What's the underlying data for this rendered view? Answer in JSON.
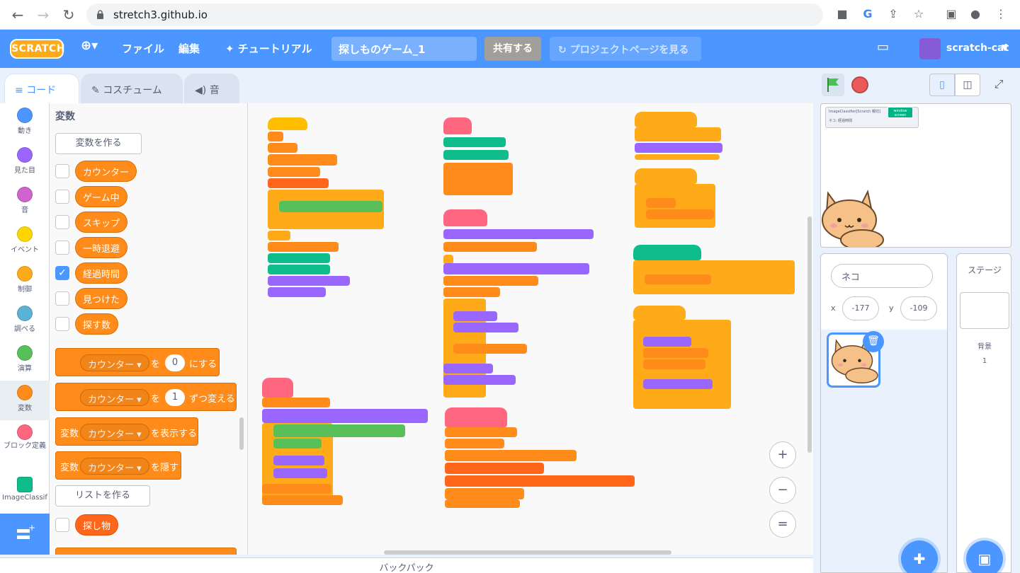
{
  "browser": {
    "url": "stretch3.github.io",
    "nav": {
      "back": "←",
      "forward": "→",
      "reload": "↻"
    }
  },
  "menubar": {
    "logo": "SCRATCH",
    "language_icon": "globe-icon",
    "file": "ファイル",
    "edit": "編集",
    "tutorials": "チュートリアル",
    "project_title": "探しものゲーム_1",
    "share": "共有する",
    "see_project_page": "プロジェクトページを見る",
    "username": "scratch-cat"
  },
  "tabs": [
    {
      "label": "コード",
      "active": true
    },
    {
      "label": "コスチューム",
      "active": false
    },
    {
      "label": "音",
      "active": false
    }
  ],
  "categories": [
    {
      "label": "動き",
      "color": "#4c97ff"
    },
    {
      "label": "見た目",
      "color": "#9966ff"
    },
    {
      "label": "音",
      "color": "#cf63cf"
    },
    {
      "label": "イベント",
      "color": "#ffd500"
    },
    {
      "label": "制御",
      "color": "#ffab19"
    },
    {
      "label": "調べる",
      "color": "#5cb1d6"
    },
    {
      "label": "演算",
      "color": "#59c059"
    },
    {
      "label": "変数",
      "color": "#ff8c1a"
    },
    {
      "label": "ブロック定義",
      "color": "#ff6680"
    },
    {
      "label": "ImageClassif",
      "color": "#0fbd8c"
    }
  ],
  "palette": {
    "title": "変数",
    "make_variable": "変数を作る",
    "variables": [
      {
        "name": "カウンター",
        "checked": false
      },
      {
        "name": "ゲーム中",
        "checked": false
      },
      {
        "name": "スキップ",
        "checked": false
      },
      {
        "name": "一時退避",
        "checked": false
      },
      {
        "name": "経過時間",
        "checked": true
      },
      {
        "name": "見つけた",
        "checked": false
      },
      {
        "name": "探す数",
        "checked": false
      }
    ],
    "blocks": {
      "set_var": "カウンター",
      "set_to": "を",
      "set_value": "0",
      "set_suffix": "にする",
      "change_var": "カウンター",
      "change_to": "を",
      "change_value": "1",
      "change_suffix": "ずつ変える",
      "show_prefix": "変数",
      "show_var": "カウンター",
      "show_suffix": "を表示する",
      "hide_prefix": "変数",
      "hide_var": "カウンター",
      "hide_suffix": "を隠す"
    },
    "make_list": "リストを作る",
    "lists": [
      {
        "name": "探し物",
        "checked": false
      }
    ]
  },
  "workspace": {
    "zoom_in": "+",
    "zoom_out": "−",
    "reset": "="
  },
  "backpack": "バックパック",
  "stage": {
    "monitor_title": "ImageClassifier[Scratch 親切]",
    "monitor_label": "ネコ: 経過時間",
    "monitor_badge": "window screen"
  },
  "sprite": {
    "name": "ネコ",
    "x_label": "x",
    "x": "-177",
    "y_label": "y",
    "y": "-109"
  },
  "stage_target": {
    "title": "ステージ",
    "backdrops_label": "背景",
    "backdrops_count": "1"
  },
  "colors": {
    "accent": "#4c97ff",
    "variables": "#ff8c1a",
    "control": "#ffab19",
    "events": "#ffbf00",
    "operators": "#59c059",
    "looks": "#9966ff",
    "myblocks": "#ff6680",
    "extension": "#0fbd8c",
    "lists": "#ff661a"
  }
}
